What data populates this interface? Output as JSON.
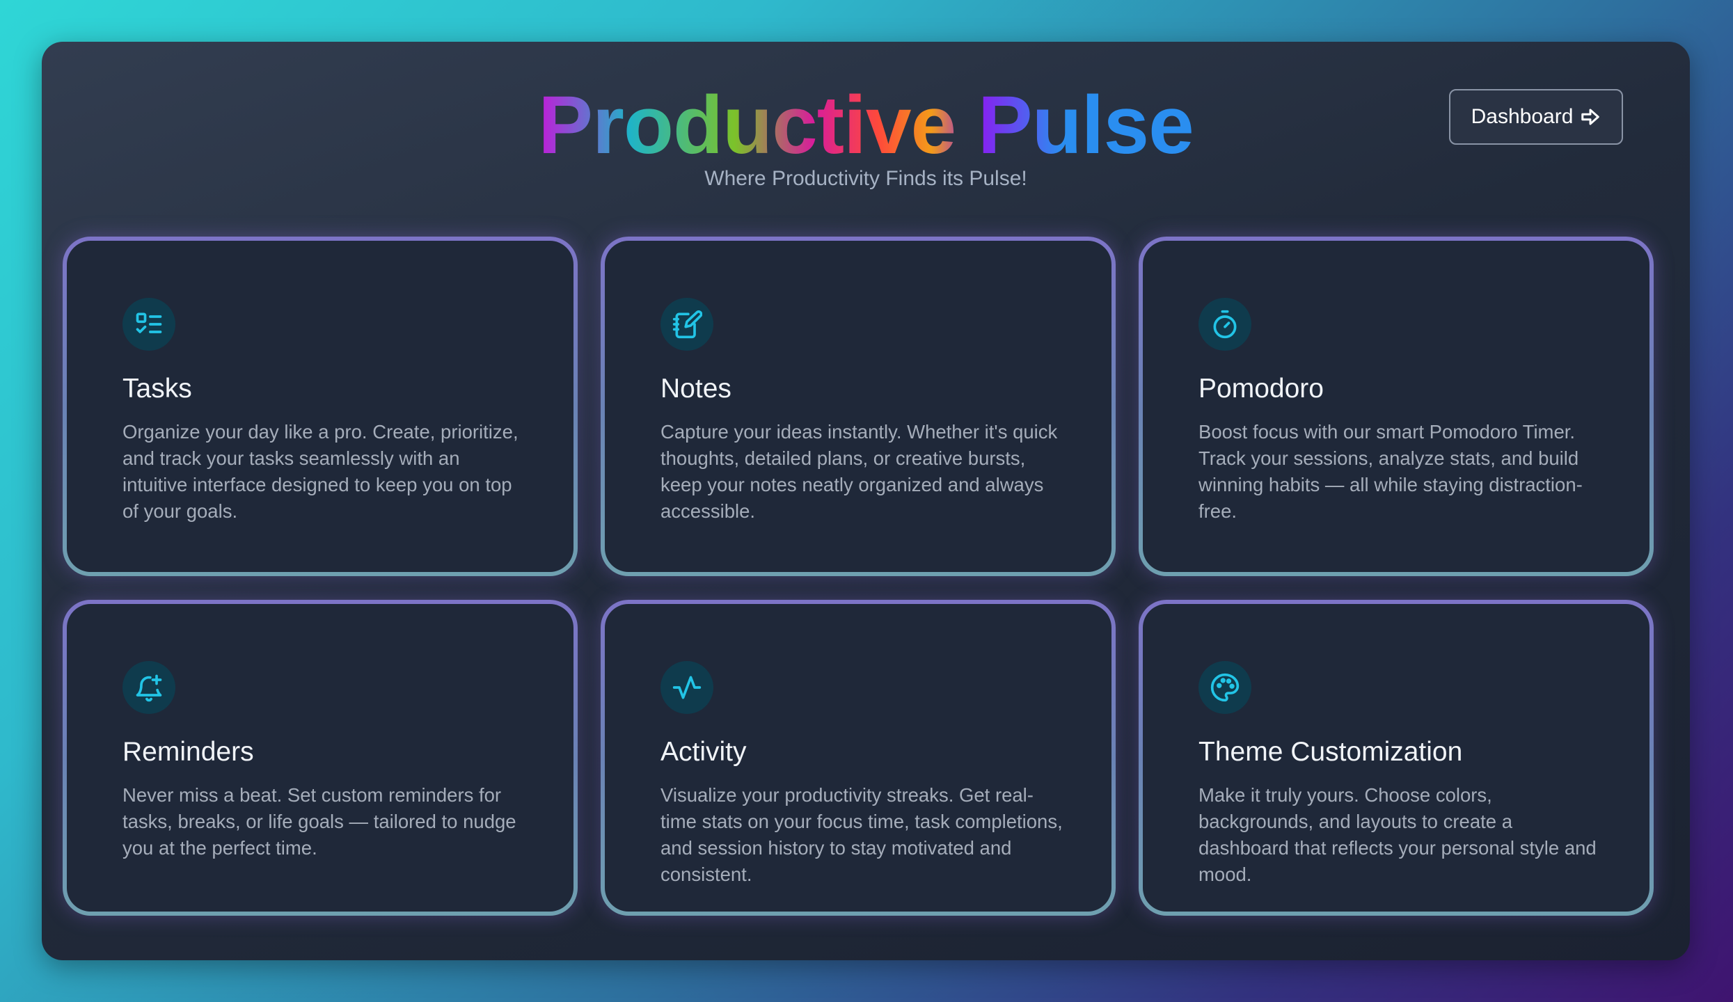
{
  "header": {
    "title": "Productive Pulse",
    "subtitle": "Where Productivity Finds its Pulse!",
    "dashboard_button": "Dashboard"
  },
  "icons": {
    "dashboard": "arrow-right-icon",
    "tasks": "list-check-icon",
    "notes": "notebook-pen-icon",
    "pomodoro": "timer-icon",
    "reminders": "bell-plus-icon",
    "activity": "activity-pulse-icon",
    "theme": "palette-icon"
  },
  "colors": {
    "accent_icon": "#22c4e6",
    "card_bg": "#1f2839",
    "icon_bg": "#0f3b4d"
  },
  "cards": [
    {
      "title": "Tasks",
      "description": "Organize your day like a pro. Create, prioritize, and track your tasks seamlessly with an intuitive interface designed to keep you on top of your goals."
    },
    {
      "title": "Notes",
      "description": "Capture your ideas instantly. Whether it's quick thoughts, detailed plans, or creative bursts, keep your notes neatly organized and always accessible."
    },
    {
      "title": "Pomodoro",
      "description": "Boost focus with our smart Pomodoro Timer. Track your sessions, analyze stats, and build winning habits — all while staying distraction-free."
    },
    {
      "title": "Reminders",
      "description": "Never miss a beat. Set custom reminders for tasks, breaks, or life goals — tailored to nudge you at the perfect time."
    },
    {
      "title": "Activity",
      "description": "Visualize your productivity streaks. Get real-time stats on your focus time, task completions, and session history to stay motivated and consistent."
    },
    {
      "title": "Theme Customization",
      "description": "Make it truly yours. Choose colors, backgrounds, and layouts to create a dashboard that reflects your personal style and mood."
    }
  ]
}
